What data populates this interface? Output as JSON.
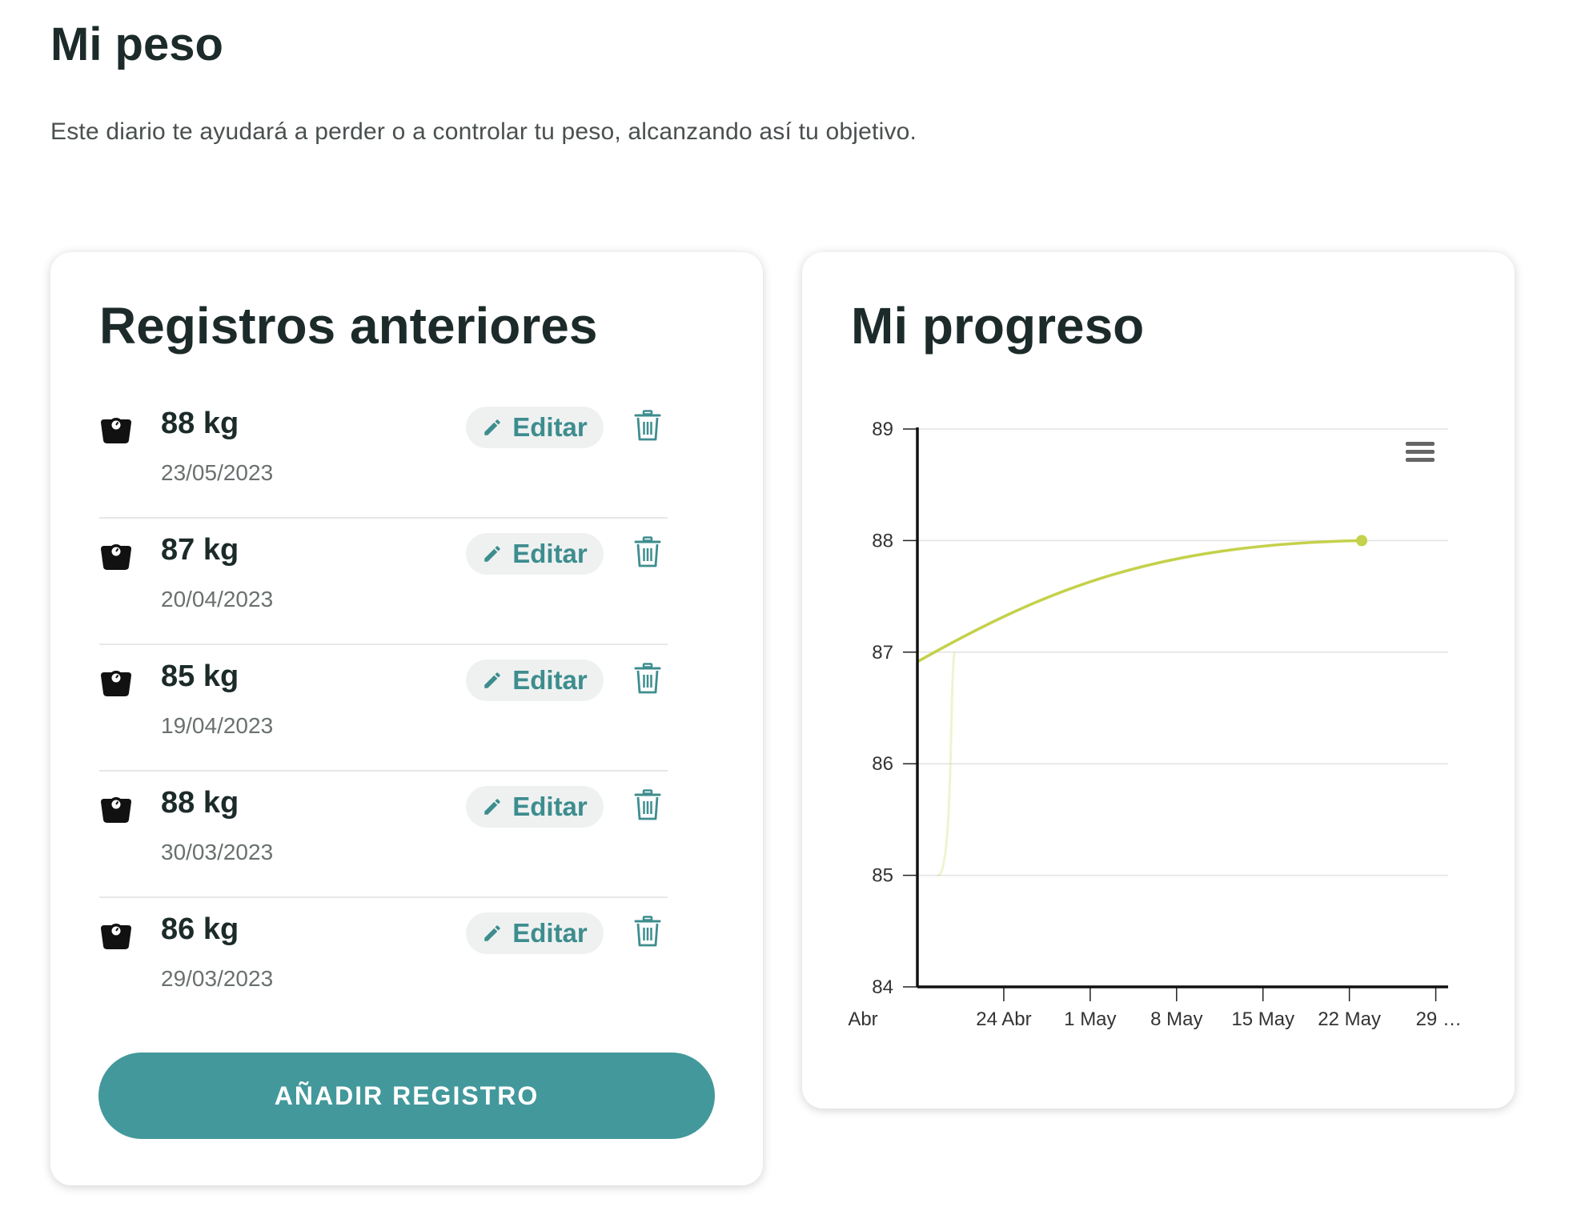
{
  "page": {
    "title": "Mi peso",
    "subtitle": "Este diario te ayudará a perder o a controlar tu peso, alcanzando así tu objetivo."
  },
  "records_card": {
    "title": "Registros anteriores",
    "edit_label": "Editar",
    "add_button_label": "AÑADIR REGISTRO",
    "icons": {
      "scale": "scale-icon",
      "edit": "pencil-icon",
      "delete": "trash-icon"
    },
    "items": [
      {
        "weight": "88 kg",
        "date": "23/05/2023"
      },
      {
        "weight": "87 kg",
        "date": "20/04/2023"
      },
      {
        "weight": "85 kg",
        "date": "19/04/2023"
      },
      {
        "weight": "88 kg",
        "date": "30/03/2023"
      },
      {
        "weight": "86 kg",
        "date": "29/03/2023"
      }
    ]
  },
  "progress_card": {
    "title": "Mi progreso",
    "menu_icon": "hamburger-menu-icon"
  },
  "chart_data": {
    "type": "line",
    "title": "",
    "xlabel": "",
    "ylabel": "",
    "ylim": [
      84,
      89
    ],
    "yticks": [
      89,
      88,
      87,
      86,
      85,
      84
    ],
    "xticks": [
      "Abr",
      "24 Abr",
      "1 May",
      "8 May",
      "15 May",
      "22 May",
      "29 …"
    ],
    "x_range": [
      "2023-04-17",
      "2023-05-30"
    ],
    "grid": true,
    "legend": "none",
    "series": [
      {
        "color": "#c4d14a",
        "points": [
          {
            "x": "2023-04-19",
            "y": 85
          },
          {
            "x": "2023-04-20",
            "y": 87
          },
          {
            "x": "2023-05-23",
            "y": 88
          }
        ]
      }
    ]
  },
  "colors": {
    "accent": "#43989b",
    "text": "#1c2b2a",
    "line": "#c4d14a"
  }
}
